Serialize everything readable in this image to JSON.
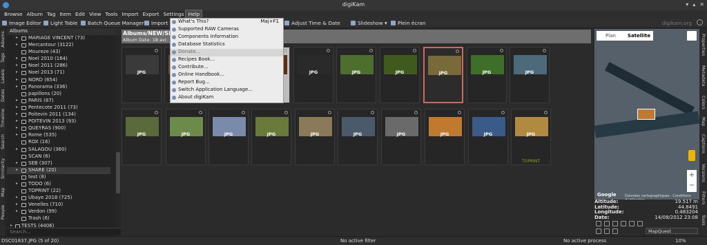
{
  "window": {
    "title": "digiKam"
  },
  "menubar": [
    "Browse",
    "Album",
    "Tag",
    "Item",
    "Edit",
    "View",
    "Tools",
    "Import",
    "Export",
    "Settings",
    "Help"
  ],
  "toolbar": {
    "image_editor": "Image Editor",
    "light_table": "Light Table",
    "batch_queue": "Batch Queue Manager",
    "import": "Import",
    "adjust_time": "Adjust Time & Date",
    "slideshow": "Slideshow",
    "fullscreen": "Plein écran",
    "brand": "digikam.org"
  },
  "left_tabs": [
    "Albums",
    "Tags",
    "Labels",
    "Dates",
    "Timeline",
    "Search",
    "Similarity",
    "Map",
    "People"
  ],
  "album_panel": {
    "header": "Albums",
    "items": [
      {
        "label": "MARIAGE VINCENT (73)",
        "type": "sub"
      },
      {
        "label": "Mercantour (3122)",
        "type": "sub"
      },
      {
        "label": "Moureze (43)",
        "type": "leaf"
      },
      {
        "label": "Noel 2010 (164)",
        "type": "sub"
      },
      {
        "label": "Noel 2011 (286)",
        "type": "sub"
      },
      {
        "label": "Noel 2013 (71)",
        "type": "sub"
      },
      {
        "label": "NORD (654)",
        "type": "sub"
      },
      {
        "label": "Panorama (336)",
        "type": "sub"
      },
      {
        "label": "papillons (20)",
        "type": "leaf"
      },
      {
        "label": "PARIS (87)",
        "type": "sub"
      },
      {
        "label": "Pentecote 2011 (73)",
        "type": "sub"
      },
      {
        "label": "Poitevin 2011 (134)",
        "type": "sub"
      },
      {
        "label": "POITEVIN 2013 (93)",
        "type": "sub"
      },
      {
        "label": "QUEYRAS (900)",
        "type": "sub"
      },
      {
        "label": "Rome (535)",
        "type": "sub"
      },
      {
        "label": "ROX (16)",
        "type": "leaf"
      },
      {
        "label": "SALAGOU (360)",
        "type": "sub"
      },
      {
        "label": "SCAN (6)",
        "type": "leaf"
      },
      {
        "label": "SEB (307)",
        "type": "sub"
      },
      {
        "label": "SHARE (20)",
        "type": "sub",
        "selected": true
      },
      {
        "label": "test (8)",
        "type": "leaf"
      },
      {
        "label": "TODO (6)",
        "type": "sub"
      },
      {
        "label": "TOPRINT (22)",
        "type": "leaf"
      },
      {
        "label": "Ubaye 2018 (725)",
        "type": "sub"
      },
      {
        "label": "Venelles (710)",
        "type": "sub"
      },
      {
        "label": "Verdon (99)",
        "type": "sub"
      },
      {
        "label": "Trash (6)",
        "type": "leaf"
      },
      {
        "label": "TESTS (4406)",
        "type": "top"
      }
    ],
    "search_placeholder": "Search..."
  },
  "album_header": {
    "title": "Albums/NEW/SH",
    "date": "Album Date: 18 avr."
  },
  "thumbnails": {
    "label": "JPG",
    "row1_colors": [
      "#3a3a3a",
      "#6b4a2a",
      "#5a3010",
      "#2a2a2a",
      "#4e6e2e",
      "#3f5a1c",
      "#7a6a3a",
      "#3e6e2a",
      "#4d6a7a"
    ],
    "row2_colors": [
      "#5a6a3a",
      "#6c8a4a",
      "#7a8aaa",
      "#6a7a3a",
      "#8a7a5a",
      "#4a5a6a",
      "#6a6a6a",
      "#c07a30",
      "#3a5a8a",
      "#b08a40"
    ],
    "toprint_label": "TOPRINT"
  },
  "help_menu": [
    {
      "label": "What's This?",
      "shortcut": "Maj+F1"
    },
    {
      "label": "Supported RAW Cameras",
      "shortcut": ""
    },
    {
      "label": "Components Information",
      "shortcut": ""
    },
    {
      "label": "Database Statistics",
      "shortcut": ""
    },
    {
      "label": "Donate...",
      "shortcut": "",
      "dim": true
    },
    {
      "label": "Recipes Book...",
      "shortcut": ""
    },
    {
      "label": "Contribute...",
      "shortcut": ""
    },
    {
      "label": "Online Handbook...",
      "shortcut": ""
    },
    {
      "label": "Report Bug...",
      "shortcut": ""
    },
    {
      "label": "Switch Application Language...",
      "shortcut": ""
    },
    {
      "label": "About digiKam",
      "shortcut": ""
    }
  ],
  "map": {
    "tab_plan": "Plan",
    "tab_satellite": "Satellite",
    "google": "Google",
    "attribution": "Données cartographiques · Conditions d'utilisation",
    "source": "MapQuest"
  },
  "metadata": {
    "altitude_label": "Altitude:",
    "altitude": "19.517 m",
    "latitude_label": "Latitude:",
    "latitude": "44.8491",
    "longitude_label": "Longitude:",
    "longitude": "0.483204",
    "date_label": "Date:",
    "date": "14/08/2012 23:08"
  },
  "right_tabs": [
    "Properties",
    "Metadata",
    "Colors",
    "Map",
    "Captions",
    "Versions",
    "Filters",
    "Tools"
  ],
  "status": {
    "file": "DSC01837.JPG (5 of 20)",
    "filter": "No active filter",
    "process": "No active process",
    "zoom": "10%"
  }
}
